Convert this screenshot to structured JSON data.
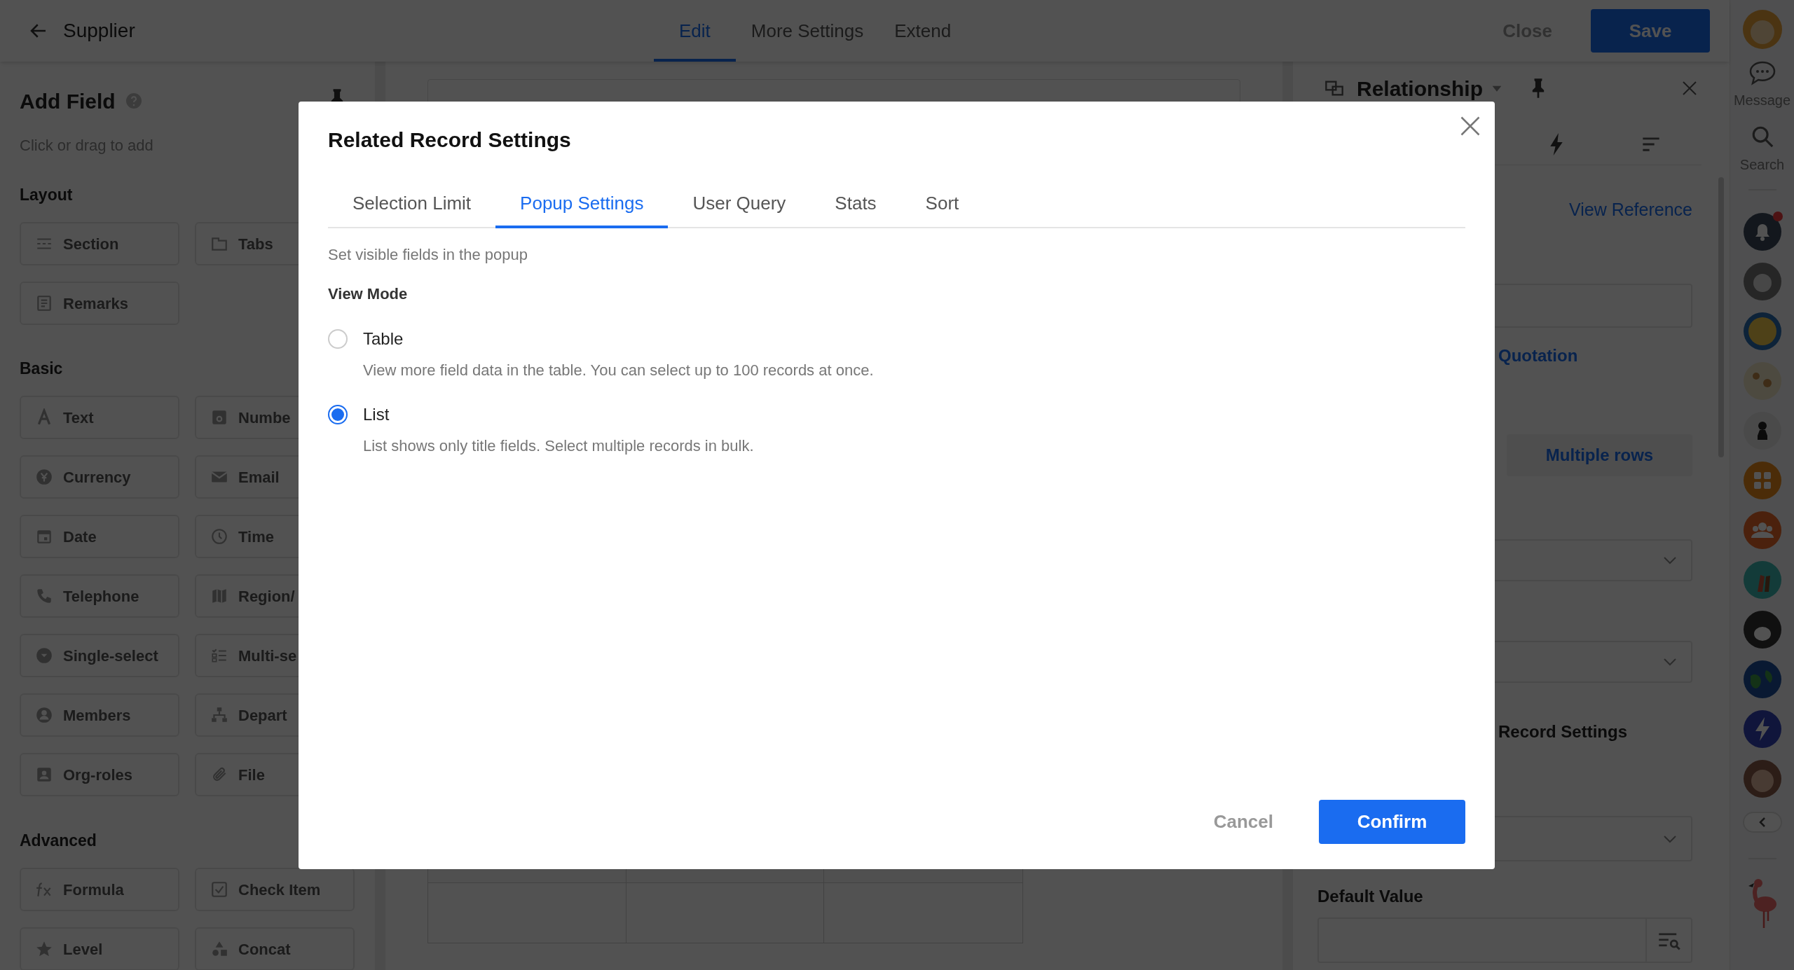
{
  "top_bar": {
    "title": "Supplier",
    "tabs": [
      {
        "label": "Edit",
        "selected": true
      },
      {
        "label": "More Settings",
        "selected": false
      },
      {
        "label": "Extend",
        "selected": false
      }
    ],
    "close_button": "Close",
    "save_button": "Save"
  },
  "left_panel": {
    "title": "Add Field",
    "hint": "Click or drag to add",
    "sections": [
      {
        "title": "Layout",
        "items": [
          "Section",
          "Tabs",
          "Remarks"
        ]
      },
      {
        "title": "Basic",
        "items": [
          "Text",
          "Numbe",
          "Currency",
          "Email",
          "Date",
          "Time",
          "Telephone",
          "Region/",
          "Single-select",
          "Multi-se",
          "Members",
          "Depart",
          "Org-roles",
          "File"
        ]
      },
      {
        "title": "Advanced",
        "items": [
          "Formula",
          "Check Item",
          "Level",
          "Concat"
        ]
      }
    ]
  },
  "right_panel": {
    "title": "Relationship",
    "view_reference": "View Reference",
    "quotation": "Quotation",
    "multiple_rows_button": "Multiple rows",
    "record_settings": "Record Settings",
    "default_value_label": "Default Value"
  },
  "sidebar": {
    "message_label": "Message",
    "search_label": "Search",
    "notification_unread": true
  },
  "modal": {
    "title": "Related Record Settings",
    "tabs": [
      {
        "label": "Selection Limit",
        "selected": false
      },
      {
        "label": "Popup Settings",
        "selected": true
      },
      {
        "label": "User Query",
        "selected": false
      },
      {
        "label": "Stats",
        "selected": false
      },
      {
        "label": "Sort",
        "selected": false
      }
    ],
    "hint": "Set visible fields in the popup",
    "view_mode_label": "View Mode",
    "options": [
      {
        "label": "Table",
        "description": "View more field data in the table. You can select up to 100 records at once.",
        "selected": false
      },
      {
        "label": "List",
        "description": "List shows only title fields. Select multiple records in bulk.",
        "selected": true
      }
    ],
    "cancel_button": "Cancel",
    "confirm_button": "Confirm"
  }
}
